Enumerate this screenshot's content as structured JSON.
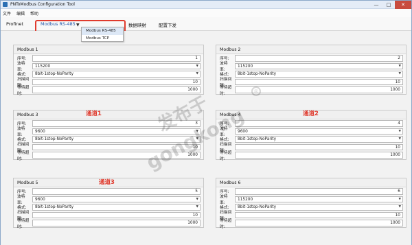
{
  "window": {
    "title": "PNToModbus Configuration Tool",
    "controls": {
      "minimize": "—",
      "maximize": "□",
      "close": "✕"
    }
  },
  "menubar": {
    "items": [
      "文件",
      "编辑",
      "帮助"
    ]
  },
  "tabs": {
    "items": [
      "Profinet",
      "Modbus RS-485",
      "数据映射",
      "配置下发"
    ],
    "hidden_label": "..."
  },
  "dropdown": {
    "options": [
      "Modbus RS-485",
      "Modbus TCP"
    ],
    "selected": "Modbus RS-485"
  },
  "field_labels": {
    "station": "序号:",
    "baud": "波特率:",
    "format": "格式:",
    "poll": "扫描间隔:",
    "timeout": "等待超时:"
  },
  "groups": [
    {
      "title": "Modbus 1",
      "station": "1",
      "baud": "115200",
      "format": "8bit-1stop-NoParity",
      "poll": "10",
      "timeout": "1000"
    },
    {
      "title": "Modbus 2",
      "station": "2",
      "baud": "115200",
      "format": "8bit-1stop-NoParity",
      "poll": "10",
      "timeout": "1000"
    },
    {
      "title": "Modbus 3",
      "station": "3",
      "baud": "9600",
      "format": "8bit-1stop-NoParity",
      "poll": "10",
      "timeout": "1000"
    },
    {
      "title": "Modbus 4",
      "station": "4",
      "baud": "9600",
      "format": "8bit-1stop-NoParity",
      "poll": "10",
      "timeout": "1000"
    },
    {
      "title": "Modbus 5",
      "station": "5",
      "baud": "9600",
      "format": "8bit-1stop-NoParity",
      "poll": "10",
      "timeout": "1000"
    },
    {
      "title": "Modbus 6",
      "station": "6",
      "baud": "115200",
      "format": "8bit-1stop-NoParity",
      "poll": "10",
      "timeout": "1000"
    }
  ],
  "annotations": [
    "通道1",
    "通道2",
    "通道3"
  ],
  "watermark": {
    "line1": "发布于",
    "line2": "gongkong",
    "mark": "®"
  },
  "colors": {
    "highlight": "#e03b2e",
    "active_tab": "#1f55a8"
  }
}
